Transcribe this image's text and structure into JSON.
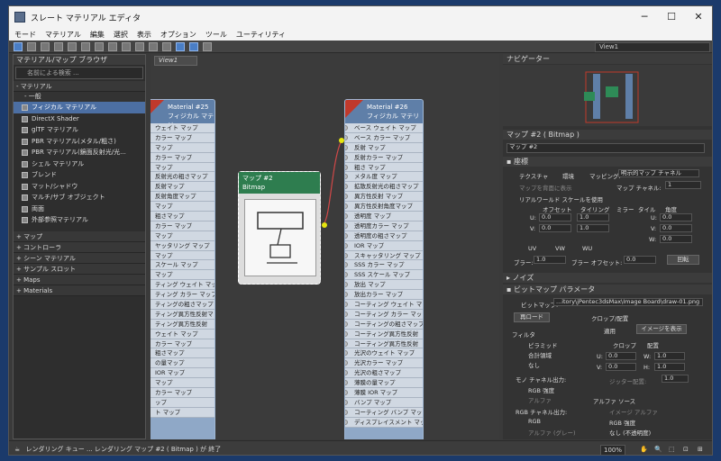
{
  "window": {
    "title": "スレート マテリアル エディタ",
    "minimize": "─",
    "maximize": "☐",
    "close": "✕"
  },
  "menu": [
    "モード",
    "マテリアル",
    "編集",
    "選択",
    "表示",
    "オプション",
    "ツール",
    "ユーティリティ"
  ],
  "view_select": "View1",
  "browser": {
    "title": "マテリアル/マップ ブラウザ",
    "search_placeholder": "名前による検索 ...",
    "sections": {
      "materials": "- マテリアル",
      "general": "- 一般",
      "maps": "+ マップ",
      "controllers": "+ コントローラ",
      "scene": "+ シーン マテリアル",
      "samples": "+ サンプル スロット",
      "maps2": "+ Maps",
      "materials2": "+ Materials"
    },
    "items": [
      "フィジカル マテリアル",
      "DirectX Shader",
      "glTF マテリアル",
      "PBR マテリアル(メタル/粗さ)",
      "PBR マテリアル(鏡面反射光/光...",
      "シェル マテリアル",
      "ブレンド",
      "マット/シャドウ",
      "マルチ/サブ オブジェクト",
      "両面",
      "外部参照マテリアル"
    ]
  },
  "view": {
    "tab": "View1",
    "node25": {
      "title1": "Material #25",
      "title2": "フィジカル マテリ",
      "slots": [
        "ウェイト マップ",
        "カラー マップ",
        "マップ",
        "カラー マップ",
        "マップ",
        "反射光の粗さマップ",
        "反射マップ",
        "反射角度マップ",
        "マップ",
        "粗さマップ",
        "カラー マップ",
        "マップ",
        "ヤッタリング マップ",
        "マップ",
        "スケール マップ",
        "マップ",
        "ティング ウェイト マップ",
        "ティング カラー マップ",
        "ティングの粗さマップ",
        "ティング異方性反射マ",
        "ティング異方性反射",
        "ウェイト マップ",
        "カラー マップ",
        "粗さマップ",
        "の量マップ",
        "IOR マップ",
        "マップ",
        "カラー マップ",
        "ップ",
        "ト マップ"
      ]
    },
    "bitmap": {
      "title1": "マップ #2",
      "title2": "Bitmap"
    },
    "node26": {
      "title1": "Material #26",
      "title2": "フィジカル マテリ",
      "slots": [
        "ベース ウェイト マップ",
        "ベース カラー マップ",
        "反射 マップ",
        "反射カラー マップ",
        "粗さ マップ",
        "メタル度 マップ",
        "拡散反射光の粗さマップ",
        "異方性反射 マップ",
        "異方性反射角度マップ",
        "透明度 マップ",
        "透明度カラー マップ",
        "透明度の粗さマップ",
        "IOR マップ",
        "スキャッタリング マップ",
        "SSS カラー マップ",
        "SSS スケール マップ",
        "放出 マップ",
        "放出カラー マップ",
        "コーティング ウェイト マップ",
        "コーティング カラー マップ",
        "コーティングの粗さマップ",
        "コーティング異方性反射",
        "コーティング異方性反射",
        "光沢のウェイト マップ",
        "光沢カラー マップ",
        "光沢の粗さマップ",
        "薄膜の量マップ",
        "薄膜 IOR マップ",
        "バンプ マップ",
        "コーティング バンプ マップ",
        "ディスプレイスメント マップ"
      ]
    }
  },
  "right": {
    "navigator": "ナビゲーター",
    "param_title": "マップ #2 ( Bitmap )",
    "name_field": "マップ #2",
    "coords": {
      "title": "座標",
      "texture": "テクスチャ",
      "env": "環境",
      "mapping_label": "マッピング:",
      "mapping_value": "明示的マップ チャネル",
      "show_map": "マップを背面に表示",
      "map_channel_label": "マップ チャネル:",
      "map_channel_value": "1",
      "realworld": "リアルワールド スケールを使用",
      "offset": "オフセット",
      "tiling": "タイリング",
      "mirror": "ミラー",
      "tile": "タイル",
      "angle": "角度",
      "u_off": "0.0",
      "v_off": "0.0",
      "u_tile": "1.0",
      "v_tile": "1.0",
      "u_ang": "0.0",
      "v_ang": "0.0",
      "w_ang": "0.0",
      "uv": "UV",
      "vw": "VW",
      "wu": "WU",
      "blur_label": "ブラー:",
      "blur": "1.0",
      "blur_off_label": "ブラー オフセット:",
      "blur_off": "0.0",
      "rotate": "回転"
    },
    "noise": "ノイズ",
    "bitmap_params": {
      "title": "ビットマップ パラメータ",
      "bitmap_label": "ビットマップ:",
      "bitmap_path": "...itory\\jPentec3dsMax\\Image Board\\draw-01.png",
      "reload": "再ロード",
      "crop_title": "クロップ/配置",
      "apply": "適用",
      "view_image": "イメージを表示",
      "crop": "クロップ",
      "place": "配置",
      "filter": "フィルタ",
      "pyramid": "ピラミッド",
      "sum": "合計領域",
      "none": "なし",
      "u_label": "U:",
      "v_label": "V:",
      "w_label": "W:",
      "h_label": "H:",
      "u": "0.0",
      "v": "0.0",
      "w": "1.0",
      "h": "1.0",
      "jitter": "ジッター配置:",
      "jitter_val": "1.0",
      "mono": "モノ チャネル出力:",
      "rgb_int": "RGB 強度",
      "alpha": "アルファ",
      "alpha_src": "アルファ ソース",
      "img_alpha": "イメージ アルファ",
      "alpha_rgb": "RGB 強度",
      "alpha_none": "なし (不透明度)",
      "rgb_out": "RGB チャネル出力:",
      "rgb": "RGB",
      "alpha_gray": "アルファ (グレー)"
    }
  },
  "status": {
    "text": "レンダリング キュー ... レンダリング マップ #2 ( Bitmap ) が 終了",
    "zoom": "100%"
  }
}
